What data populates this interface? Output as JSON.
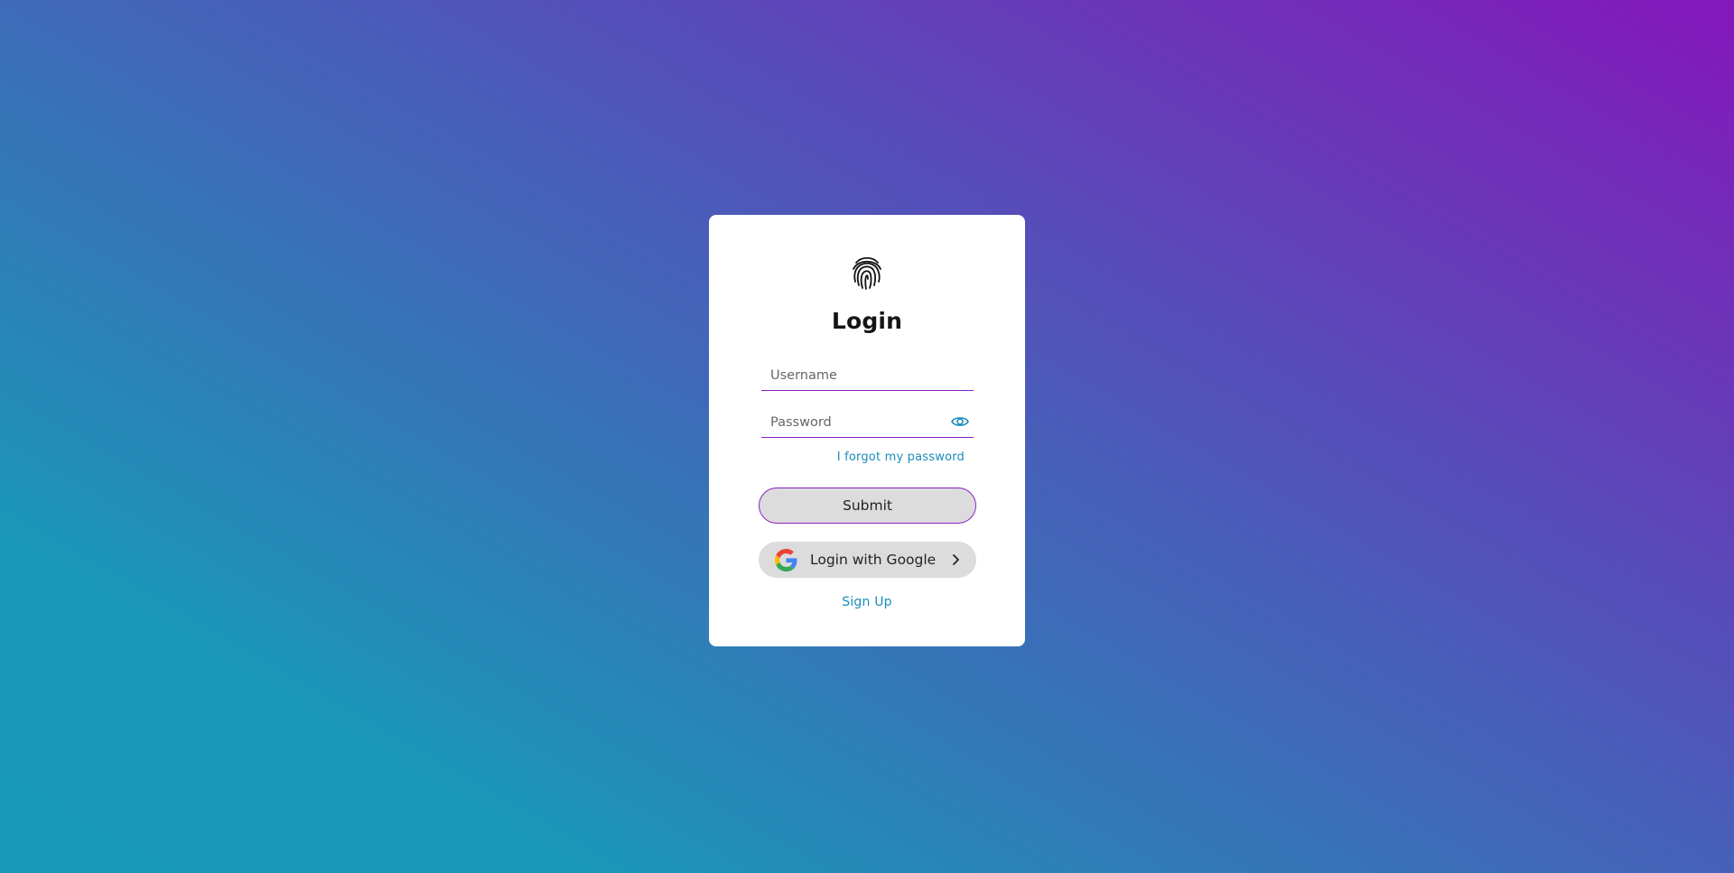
{
  "login": {
    "title": "Login",
    "username_placeholder": "Username",
    "password_placeholder": "Password",
    "forgot_label": "I forgot my password",
    "submit_label": "Submit",
    "google_label": "Login with Google",
    "signup_label": "Sign Up"
  },
  "icons": {
    "logo": "fingerprint-icon",
    "password_toggle": "eye-icon",
    "google": "google-icon",
    "chevron": "chevron-right-icon"
  },
  "colors": {
    "gradient_start": "#1898b8",
    "gradient_end": "#8417bb",
    "accent": "#8a20c4",
    "link": "#1a8db8",
    "button_bg": "#dcdcdc"
  }
}
